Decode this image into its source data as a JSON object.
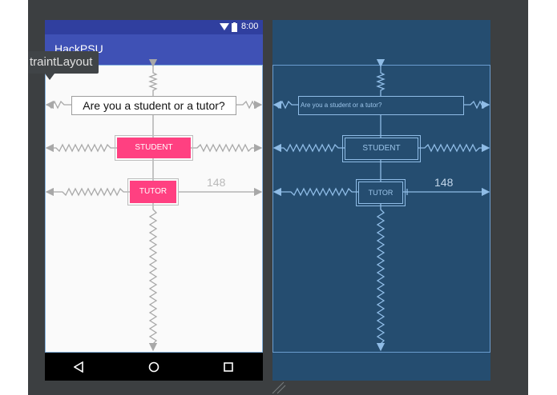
{
  "status_bar": {
    "time": "8:00"
  },
  "app_bar": {
    "title": "HackPSU"
  },
  "tooltip": {
    "text": "traintLayout"
  },
  "question": {
    "text": "Are you a student or a tutor?"
  },
  "buttons": {
    "student": "STUDENT",
    "tutor": "TUTOR"
  },
  "blueprint": {
    "question": "Are you a student or a tutor?",
    "student": "STUDENT",
    "tutor": "TUTOR"
  },
  "dimension": {
    "tutor_right_margin": "148"
  },
  "nav": {
    "back_icon": "back-triangle-icon",
    "home_icon": "home-circle-icon",
    "recents_icon": "recents-square-icon"
  },
  "colors": {
    "primary": "#3f51b5",
    "primary_dark": "#303f9f",
    "accent": "#ff4081",
    "blueprint_bg": "#254d70",
    "canvas_bg": "#3c3f41"
  }
}
